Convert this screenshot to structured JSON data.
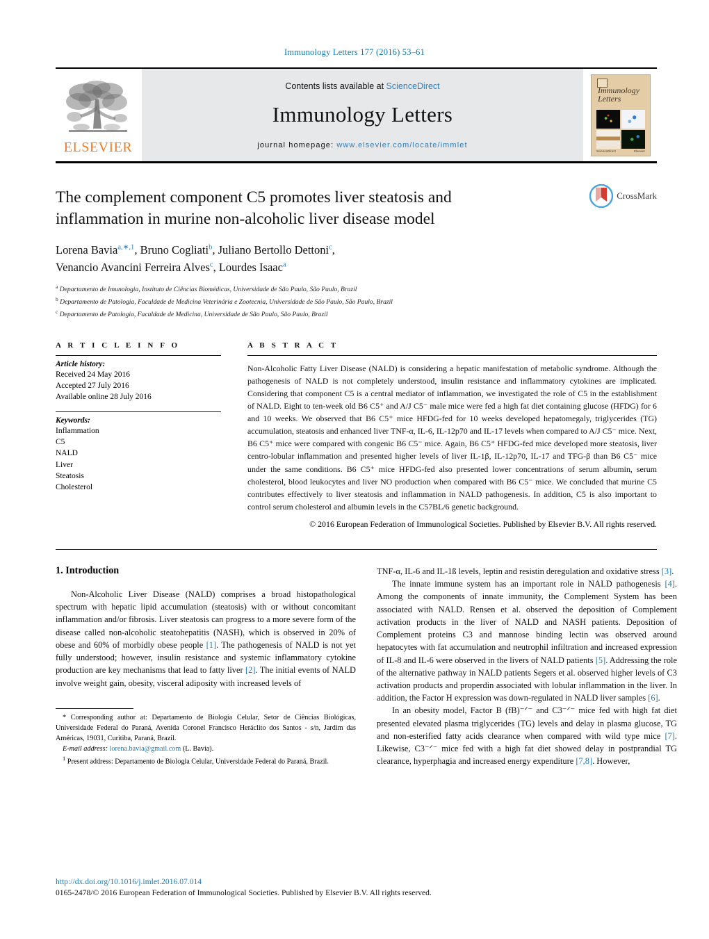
{
  "running_head": "Immunology Letters 177 (2016) 53–61",
  "masthead": {
    "publisher_name": "ELSEVIER",
    "contents_prefix": "Contents lists available at ",
    "contents_link": "ScienceDirect",
    "journal_title": "Immunology Letters",
    "homepage_prefix": "journal homepage:",
    "homepage_url": "www.elsevier.com/locate/immlet",
    "cover_title": "Immunology Letters"
  },
  "crossmark": {
    "label": "CrossMark"
  },
  "article": {
    "title": "The complement component C5 promotes liver steatosis and inflammation in murine non-alcoholic liver disease model",
    "authors_line1_a": "Lorena Bavia",
    "authors_line1_a_sup": "a,∗,1",
    "authors_line1_b": ", Bruno Cogliati",
    "authors_line1_b_sup": "b",
    "authors_line1_c": ", Juliano Bertollo Dettoni",
    "authors_line1_c_sup": "c",
    "authors_line1_end": ",",
    "authors_line2_a": "Venancio Avancini Ferreira Alves",
    "authors_line2_a_sup": "c",
    "authors_line2_b": ", Lourdes Isaac",
    "authors_line2_b_sup": "a",
    "affiliations": [
      {
        "sup": "a",
        "text": "Departamento de Imunologia, Instituto de Ciências Biomédicas, Universidade de São Paulo, São Paulo, Brazil"
      },
      {
        "sup": "b",
        "text": "Departamento de Patologia, Faculdade de Medicina Veterinária e Zootecnia, Universidade de São Paulo, São Paulo, Brazil"
      },
      {
        "sup": "c",
        "text": "Departamento de Patologia, Faculdade de Medicina, Universidade de São Paulo, São Paulo, Brazil"
      }
    ]
  },
  "article_info": {
    "heading": "A R T I C L E  I N F O",
    "history_label": "Article history:",
    "history": [
      "Received 24 May 2016",
      "Accepted 27 July 2016",
      "Available online 28 July 2016"
    ],
    "keywords_label": "Keywords:",
    "keywords": [
      "Inflammation",
      "C5",
      "NALD",
      "Liver",
      "Steatosis",
      "Cholesterol"
    ]
  },
  "abstract": {
    "heading": "A B S T R A C T",
    "text": "Non-Alcoholic Fatty Liver Disease (NALD) is considering a hepatic manifestation of metabolic syndrome. Although the pathogenesis of NALD is not completely understood, insulin resistance and inflammatory cytokines are implicated. Considering that component C5 is a central mediator of inflammation, we investigated the role of C5 in the establishment of NALD. Eight to ten-week old B6 C5⁺ and A/J C5⁻ male mice were fed a high fat diet containing glucose (HFDG) for 6 and 10 weeks. We observed that B6 C5⁺ mice HFDG-fed for 10 weeks developed hepatomegaly, triglycerides (TG) accumulation, steatosis and enhanced liver TNF-α, IL-6, IL-12p70 and IL-17 levels when compared to A/J C5⁻ mice. Next, B6 C5⁺ mice were compared with congenic B6 C5⁻ mice. Again, B6 C5⁺ HFDG-fed mice developed more steatosis, liver centro-lobular inflammation and presented higher levels of liver IL-1β, IL-12p70, IL-17 and TFG-β than B6 C5⁻ mice under the same conditions. B6 C5⁺ mice HFDG-fed also presented lower concentrations of serum albumin, serum cholesterol, blood leukocytes and liver NO production when compared with B6 C5⁻ mice. We concluded that murine C5 contributes effectively to liver steatosis and inflammation in NALD pathogenesis. In addition, C5 is also important to control serum cholesterol and albumin levels in the C57BL/6 genetic background.",
    "copyright": "© 2016 European Federation of Immunological Societies. Published by Elsevier B.V. All rights reserved."
  },
  "body": {
    "section1_heading": "1.  Introduction",
    "left_para1_start": "Non-Alcoholic Liver Disease (NALD) comprises a broad histopathological spectrum with hepatic lipid accumulation (steatosis) with or without concomitant inflammation and/or fibrosis. Liver steatosis can progress to a more severe form of the disease called non-alcoholic steatohepatitis (NASH), which is observed in 20% of obese and 60% of morbidly obese people ",
    "left_ref1": "[1]",
    "left_para1_mid": ". The pathogenesis of NALD is not yet fully understood; however, insulin resistance and systemic inflammatory cytokine production are key mechanisms that lead to fatty liver ",
    "left_ref2": "[2]",
    "left_para1_end": ". The initial events of NALD involve weight gain, obesity, visceral adiposity with increased levels of",
    "right_cont_start": "TNF-α, IL-6 and IL-1ß levels, leptin and resistin deregulation and oxidative stress ",
    "right_ref3": "[3]",
    "right_cont_end": ".",
    "right_para2_start": "The innate immune system has an important role in NALD pathogenesis ",
    "right_ref4": "[4]",
    "right_para2_mid": ". Among the components of innate immunity, the Complement System has been associated with NALD. Rensen et al. observed the deposition of Complement activation products in the liver of NALD and NASH patients. Deposition of Complement proteins C3 and mannose binding lectin was observed around hepatocytes with fat accumulation and neutrophil infiltration and increased expression of IL-8 and IL-6 were observed in the livers of NALD patients ",
    "right_ref5": "[5]",
    "right_para2_mid2": ". Addressing the role of the alternative pathway in NALD patients Segers et al. observed higher levels of C3 activation products and properdin associated with lobular inflammation in the liver. In addition, the Factor H expression was down-regulated in NALD liver samples ",
    "right_ref6": "[6]",
    "right_para2_end": ".",
    "right_para3_start": "In an obesity model, Factor B (fB)⁻ᐟ⁻ and C3⁻ᐟ⁻ mice fed with high fat diet presented elevated plasma triglycerides (TG) levels and delay in plasma glucose, TG and non-esterified fatty acids clearance when compared with wild type mice ",
    "right_ref7": "[7]",
    "right_para3_mid": ". Likewise, C3⁻ᐟ⁻ mice fed with a high fat diet showed delay in postprandial TG clearance, hyperphagia and increased energy expenditure ",
    "right_ref78": "[7,8]",
    "right_para3_end": ". However,"
  },
  "footnotes": {
    "corresponding": "* Corresponding author at: Departamento de Biologia Celular, Setor de Ciências Biológicas, Universidade Federal do Paraná, Avenida Coronel Francisco Heráclito dos Santos - s/n, Jardim das Américas, 19031, Curitiba, Paraná, Brazil.",
    "email_label": "E-mail address:",
    "email": "lorena.bavia@gmail.com",
    "email_suffix": "(L. Bavia).",
    "present_marker": "1",
    "present_address": "Present address: Departamento de Biologia Celular, Universidade Federal do Paraná, Brazil."
  },
  "footer": {
    "doi": "http://dx.doi.org/10.1016/j.imlet.2016.07.014",
    "issn": "0165-2478/© 2016 European Federation of Immunological Societies. Published by Elsevier B.V. All rights reserved."
  },
  "colors": {
    "link": "#1a7cb8",
    "elsevier_orange": "#f07c1f",
    "band_gray": "#e7e8ea"
  }
}
